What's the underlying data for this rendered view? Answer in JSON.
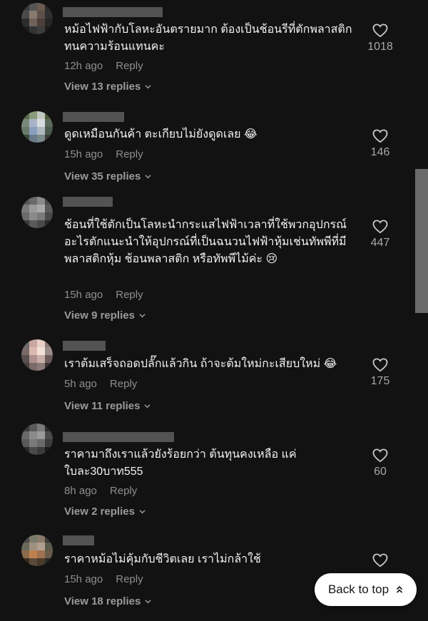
{
  "comments": [
    {
      "text": "หม้อไฟฟ้ากับโลหะอันตรายมาก ต้องเป็นช้อนรีที่ตักพลาสติกทนความร้อนแทนคะ",
      "time": "12h ago",
      "reply": "Reply",
      "view_replies": "View 13 replies",
      "likes": "1018",
      "avatar_colors": [
        "#3a3a3a",
        "#555",
        "#6b5a4e",
        "#2c2c2c",
        "#4a4a4a",
        "#8a7a6e",
        "#5e504a",
        "#303030",
        "#2d2d2d",
        "#6e625a",
        "#4b4038",
        "#262626",
        "#1e1e1e",
        "#333",
        "#3d3d3d",
        "#1b1b1b"
      ]
    },
    {
      "text": "ดูดเหมือนกันค้า ตะเกียบไม่ยังดูดเลย 😂",
      "time": "15h ago",
      "reply": "Reply",
      "view_replies": "View 35 replies",
      "likes": "146",
      "avatar_colors": [
        "#5a6a4a",
        "#8a9a7a",
        "#c0c8c0",
        "#4a5a3a",
        "#7a8a7a",
        "#aab4c8",
        "#d8dce0",
        "#5a6a5a",
        "#6a7a6a",
        "#8aa0c0",
        "#b0b8c0",
        "#4a5a4a",
        "#3a4a3a",
        "#6a7a8a",
        "#7a8a8a",
        "#3a3a3a"
      ]
    },
    {
      "text": "ช้อนที่ใช้ตักเป็นโลหะนำกระแสไฟฟ้าเวลาที่ใช้พวกอุปกรณ์อะไรตักแนะนำให้อุปกรณ์ที่เป็นฉนวนไฟฟ้าหุ้มเช่นทัพพีที่มีพลาสติกหุ้ม ช้อนพลาสติก หรือทัพพีไม้ค่ะ 😢",
      "time": "15h ago",
      "reply": "Reply",
      "view_replies": "View 9 replies",
      "likes": "447",
      "avatar_colors": [
        "#555",
        "#6a6a6a",
        "#8a8a8a",
        "#4a4a4a",
        "#7a7a7a",
        "#9a9a9a",
        "#aaaaaa",
        "#5a5a5a",
        "#6a6a6a",
        "#8a8a8a",
        "#7a7a7a",
        "#4a4a4a",
        "#3a3a3a",
        "#5a5a5a",
        "#4a4a4a",
        "#2a2a2a"
      ]
    },
    {
      "text": "เราต้มเสร็จถอดปลั๊กแล้วกิน ถ้าจะต้มใหม่กะเสียบใหม่ 😂",
      "time": "5h ago",
      "reply": "Reply",
      "view_replies": "View 11 replies",
      "likes": "175",
      "avatar_colors": [
        "#6a6a6a",
        "#c8a8a0",
        "#e8d0c8",
        "#8a7a7a",
        "#7a6a6a",
        "#d8b8b0",
        "#f0e0d8",
        "#9a8a8a",
        "#5a5050",
        "#b09090",
        "#c8b0a8",
        "#6a5a5a",
        "#4a4040",
        "#7a6a6a",
        "#8a7a7a",
        "#3a3030"
      ]
    },
    {
      "text": "ราคามาถึงเราแล้วยังร้อยกว่า ต้นทุนคงเหลือ แค่ ใบละ30บาท555",
      "time": "8h ago",
      "reply": "Reply",
      "view_replies": "View 2 replies",
      "likes": "60",
      "avatar_colors": [
        "#3a3a3a",
        "#5a5a5a",
        "#7a7a7a",
        "#2a2a2a",
        "#6a6a6a",
        "#8a8a8a",
        "#9a9a9a",
        "#4a4a4a",
        "#5a5a5a",
        "#7a7a7a",
        "#6a6a6a",
        "#3a3a3a",
        "#2a2a2a",
        "#4a4a4a",
        "#3a3a3a",
        "#1a1a1a"
      ]
    },
    {
      "text": "ราคาหม้อไม่คุ้มกับชีวิตเลย เราไม่กล้าใช้",
      "time": "15h ago",
      "reply": "Reply",
      "view_replies": "View 18 replies",
      "likes": "",
      "avatar_colors": [
        "#4a4a4a",
        "#7a7a6a",
        "#8a7a6a",
        "#3a3a3a",
        "#6a6a5a",
        "#a09080",
        "#b0a090",
        "#5a5a4a",
        "#8a6a4a",
        "#c08050",
        "#a07050",
        "#6a5a4a",
        "#3a2a1a",
        "#5a4a3a",
        "#4a3a2a",
        "#2a2a2a"
      ]
    }
  ],
  "back_to_top": {
    "label": "Back to top"
  }
}
